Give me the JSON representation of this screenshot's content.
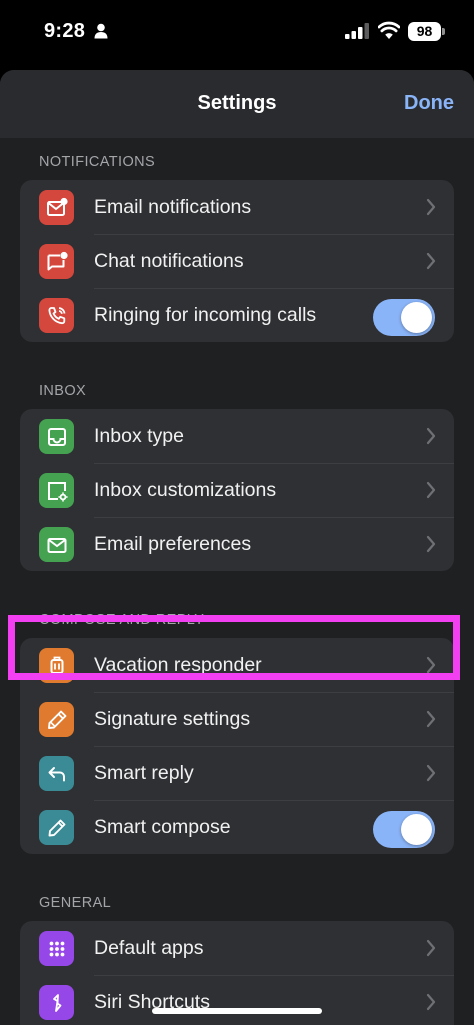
{
  "status_bar": {
    "time": "9:28",
    "battery": "98"
  },
  "nav": {
    "title": "Settings",
    "done_label": "Done"
  },
  "sections": [
    {
      "header": "NOTIFICATIONS",
      "items": [
        {
          "label": "Email notifications",
          "icon": "mail-badge-icon",
          "color": "#d4473c",
          "control": "chevron"
        },
        {
          "label": "Chat notifications",
          "icon": "chat-badge-icon",
          "color": "#d4473c",
          "control": "chevron"
        },
        {
          "label": "Ringing for incoming calls",
          "icon": "phone-ringing-icon",
          "color": "#d4473c",
          "control": "toggle",
          "on": true
        }
      ]
    },
    {
      "header": "INBOX",
      "items": [
        {
          "label": "Inbox type",
          "icon": "inbox-icon",
          "color": "#44a251",
          "control": "chevron"
        },
        {
          "label": "Inbox customizations",
          "icon": "inbox-settings-icon",
          "color": "#44a251",
          "control": "chevron"
        },
        {
          "label": "Email preferences",
          "icon": "envelope-icon",
          "color": "#44a251",
          "control": "chevron"
        }
      ]
    },
    {
      "header": "COMPOSE AND REPLY",
      "items": [
        {
          "label": "Vacation responder",
          "icon": "luggage-icon",
          "color": "#e07a2e",
          "control": "chevron"
        },
        {
          "label": "Signature settings",
          "icon": "pen-icon",
          "color": "#e07a2e",
          "control": "chevron"
        },
        {
          "label": "Smart reply",
          "icon": "reply-icon",
          "color": "#3a8b95",
          "control": "chevron"
        },
        {
          "label": "Smart compose",
          "icon": "pencil-icon",
          "color": "#3a8b95",
          "control": "toggle",
          "on": true
        }
      ]
    },
    {
      "header": "GENERAL",
      "items": [
        {
          "label": "Default apps",
          "icon": "apps-grid-icon",
          "color": "#9547e8",
          "control": "chevron"
        },
        {
          "label": "Siri Shortcuts",
          "icon": "shortcuts-icon",
          "color": "#9547e8",
          "control": "chevron"
        }
      ]
    }
  ],
  "accent_color": "#8ab4f8",
  "highlight_color": "#f23ff1"
}
